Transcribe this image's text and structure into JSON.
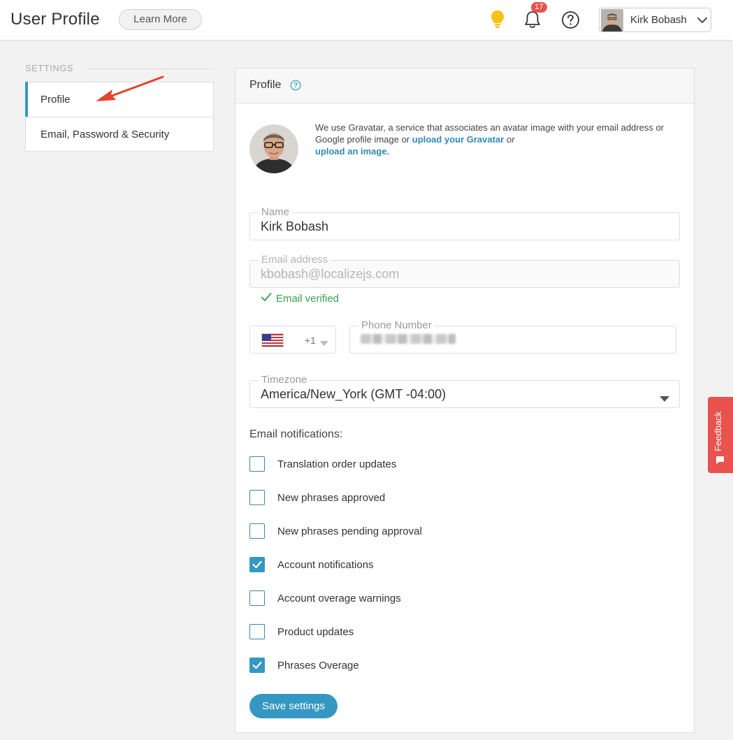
{
  "header": {
    "title": "User Profile",
    "learn_more": "Learn More",
    "notification_count": "17",
    "user_name": "Kirk Bobash",
    "icons": [
      "lightbulb-icon",
      "bell-icon",
      "help-icon",
      "chevron-down-icon"
    ]
  },
  "sidebar": {
    "section_label": "SETTINGS",
    "items": [
      {
        "label": "Profile",
        "active": true
      },
      {
        "label": "Email, Password & Security",
        "active": false
      }
    ]
  },
  "profile": {
    "card_title": "Profile",
    "gravatar": {
      "text_1": "We use Gravatar, a service that associates an avatar image with your email address or Google profile image or ",
      "link_1": "upload your Gravatar",
      "text_2": " or",
      "link_2": "upload an image."
    },
    "name": {
      "label": "Name",
      "value": "Kirk Bobash"
    },
    "email": {
      "label": "Email address",
      "value": "kbobash@localizejs.com",
      "verified_text": "Email verified"
    },
    "phone": {
      "country_code": "+1",
      "label": "Phone Number"
    },
    "timezone": {
      "label": "Timezone",
      "value": "America/New_York (GMT -04:00)"
    },
    "notifications_title": "Email notifications:",
    "notifications": [
      {
        "label": "Translation order updates",
        "checked": false
      },
      {
        "label": "New phrases approved",
        "checked": false
      },
      {
        "label": "New phrases pending approval",
        "checked": false
      },
      {
        "label": "Account notifications",
        "checked": true
      },
      {
        "label": "Account overage warnings",
        "checked": false
      },
      {
        "label": "Product updates",
        "checked": false
      },
      {
        "label": "Phrases Overage",
        "checked": true
      }
    ],
    "save_label": "Save settings"
  },
  "feedback": {
    "label": "Feedback"
  },
  "colors": {
    "accent": "#3498c2",
    "badge": "#e8534f",
    "verified": "#3b9f4a"
  }
}
